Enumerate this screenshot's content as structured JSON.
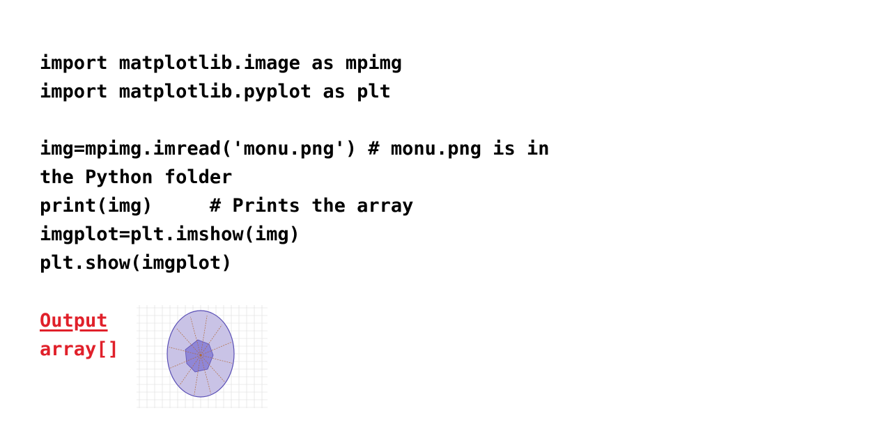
{
  "code": {
    "lines": [
      "import matplotlib.image as mpimg",
      "import matplotlib.pyplot as plt",
      "",
      "img=mpimg.imread('monu.png') # monu.png is in",
      "the Python folder",
      "print(img)     # Prints the array",
      "imgplot=plt.imshow(img)",
      "plt.show(imgplot)"
    ]
  },
  "output": {
    "label": "Output",
    "value": "array[]",
    "color": "#e0202a"
  },
  "image": {
    "icon": "ellipse-diagram-image",
    "fill_color": "#c9c3e6",
    "center_color": "#8f86d6",
    "stroke_color": "#5a4fb5",
    "line_color": "#b06a3a",
    "grid_color": "#dcdcdc"
  }
}
